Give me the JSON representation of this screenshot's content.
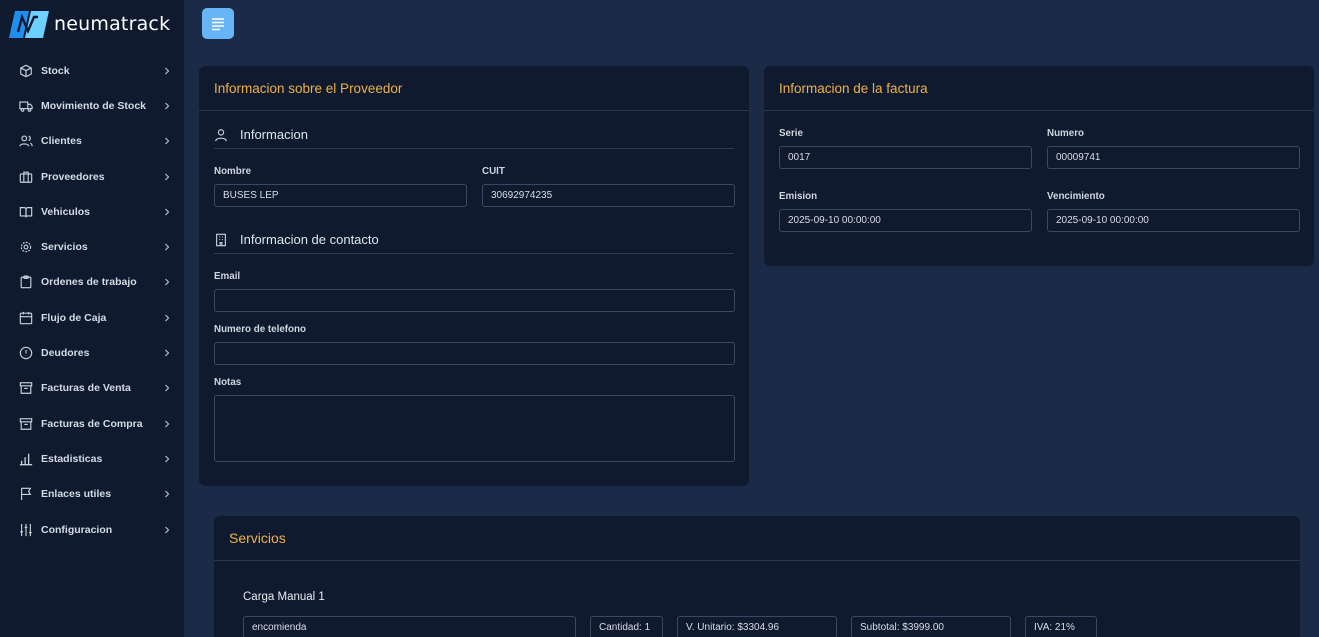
{
  "brand": {
    "name": "neumatrack",
    "logo_colors": [
      "#1e8ff0",
      "#6ed0ff"
    ]
  },
  "sidebar": {
    "items": [
      {
        "label": "Stock",
        "icon": "box-icon"
      },
      {
        "label": "Movimiento de Stock",
        "icon": "truck-icon"
      },
      {
        "label": "Clientes",
        "icon": "users-icon"
      },
      {
        "label": "Proveedores",
        "icon": "briefcase-icon"
      },
      {
        "label": "Vehiculos",
        "icon": "book-icon"
      },
      {
        "label": "Servicios",
        "icon": "gear-icon"
      },
      {
        "label": "Ordenes de trabajo",
        "icon": "clipboard-icon"
      },
      {
        "label": "Flujo de Caja",
        "icon": "calendar-icon"
      },
      {
        "label": "Deudores",
        "icon": "alert-circle-icon"
      },
      {
        "label": "Facturas de Venta",
        "icon": "archive-icon"
      },
      {
        "label": "Facturas de Compra",
        "icon": "archive-icon"
      },
      {
        "label": "Estadisticas",
        "icon": "bar-chart-icon"
      },
      {
        "label": "Enlaces utiles",
        "icon": "flag-icon"
      },
      {
        "label": "Configuracion",
        "icon": "sliders-icon"
      }
    ]
  },
  "supplier": {
    "title": "Informacion sobre el Proveedor",
    "info_section": "Informacion",
    "name_label": "Nombre",
    "name_value": "BUSES LEP",
    "cuit_label": "CUIT",
    "cuit_value": "30692974235",
    "contact_section": "Informacion de contacto",
    "email_label": "Email",
    "email_value": "",
    "phone_label": "Numero de telefono",
    "phone_value": "",
    "notes_label": "Notas",
    "notes_value": ""
  },
  "invoice": {
    "title": "Informacion de la factura",
    "serie_label": "Serie",
    "serie_value": "0017",
    "numero_label": "Numero",
    "numero_value": "00009741",
    "emision_label": "Emision",
    "emision_value": "2025-09-10 00:00:00",
    "vencimiento_label": "Vencimiento",
    "vencimiento_value": "2025-09-10 00:00:00"
  },
  "services": {
    "title": "Servicios",
    "item_title": "Carga Manual 1",
    "description": "encomienda",
    "cantidad": "Cantidad: 1",
    "unit_value": "V. Unitario: $3304.96",
    "subtotal": "Subtotal: $3999.00",
    "iva": "IVA: 21%"
  },
  "colors": {
    "accent": "#f0b048",
    "toggle": "#67b5f4",
    "panel": "#0f1a2e",
    "background": "#1b2a47"
  }
}
